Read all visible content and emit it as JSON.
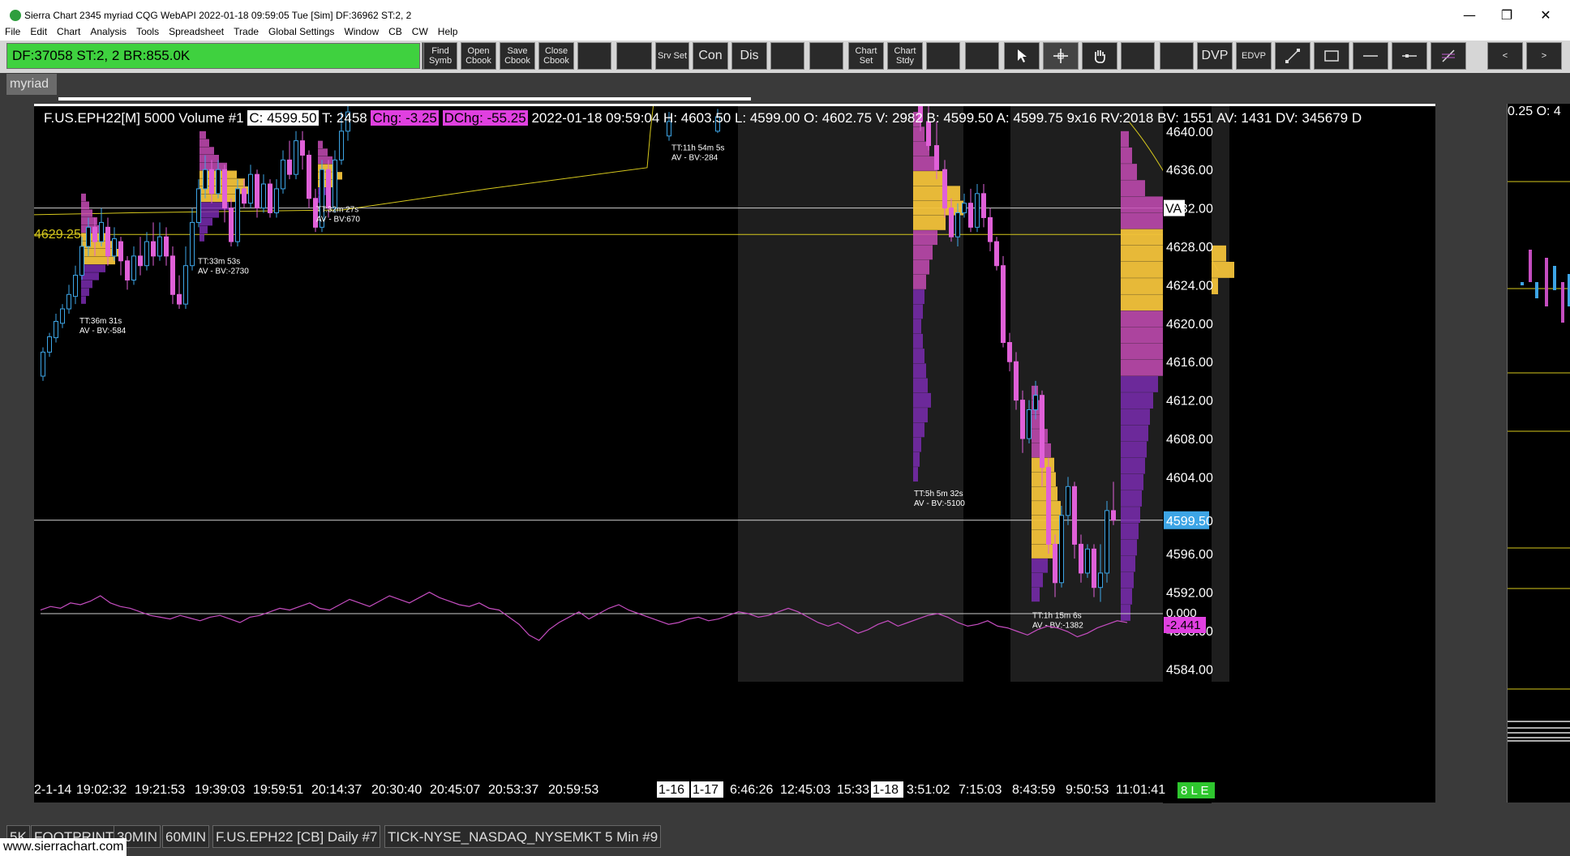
{
  "window": {
    "title": "Sierra Chart 2345 myriad  CQG WebAPI 2022-01-18  09:59:05 Tue [Sim]  DF:36962  ST:2, 2",
    "minimize": "—",
    "restore": "❐",
    "close": "✕"
  },
  "menu": [
    "File",
    "Edit",
    "Chart",
    "Analysis",
    "Tools",
    "Spreadsheet",
    "Trade",
    "Global Settings",
    "Window",
    "CB",
    "CW",
    "Help"
  ],
  "status": {
    "text": "DF:37058  ST:2, 2  BR:855.0K"
  },
  "toolbar": {
    "find_symb": "Find Symb",
    "open_cbook": "Open Cbook",
    "save_cbook": "Save Cbook",
    "close_cbook": "Close Cbook",
    "srv_set": "Srv Set",
    "con": "Con",
    "dis": "Dis",
    "chart_set": "Chart Set",
    "chart_stdy": "Chart Stdy",
    "dvp": "DVP",
    "edvp": "EDVP",
    "prev": "<",
    "next": ">"
  },
  "chartbook_tab": "myriad",
  "chart": {
    "symbol": "F.US.EPH22[M]  5000 Volume  #1",
    "close": "C: 4599.50",
    "trades": "T: 2458",
    "chg": "Chg: -3.25",
    "dchg": "DChg: -55.25",
    "details": "2022-01-18 09:59:04 H: 4603.50 L: 4599.00 O: 4602.75 V: 2982 B: 4599.50 A: 4599.75 9x16 RV:2018 BV: 1551 AV: 1431 DV: 345679 D",
    "left_level": "4629.25",
    "va_label": "VA",
    "price_box": "4599.50",
    "osc_zero": "0.000",
    "osc_value": "-2.441",
    "right_partial_header": "0.25 O: 4",
    "status_tag": "8 L E",
    "profile_notes": [
      {
        "tt": "TT:36m 31s",
        "av": "AV - BV:-584"
      },
      {
        "tt": "TT:33m 53s",
        "av": "AV - BV:-2730"
      },
      {
        "tt": "TT:32m 27s",
        "av": "AV - BV:670"
      },
      {
        "tt": "TT:11h 54m 5s",
        "av": "AV - BV:-284"
      },
      {
        "tt": "TT:5h 5m 32s",
        "av": "AV - BV:-5100"
      },
      {
        "tt": "TT:1h 15m 6s",
        "av": "AV - BV:-1382"
      }
    ],
    "time_labels": [
      "2-1-14",
      "19:02:32",
      "19:21:53",
      "19:39:03",
      "19:59:51",
      "20:14:37",
      "20:30:40",
      "20:45:07",
      "20:53:37",
      "20:59:53",
      "1-16",
      "1-17",
      "6:46:26",
      "12:45:03",
      "15:33",
      "1-18",
      "3:51:02",
      "7:15:03",
      "8:43:59",
      "9:50:53",
      "11:01:41"
    ]
  },
  "chart_data": {
    "type": "candlestick",
    "y_axis": {
      "ticks": [
        4640.0,
        4636.0,
        4632.0,
        4628.0,
        4624.0,
        4620.0,
        4616.0,
        4612.0,
        4608.0,
        4604.0,
        4596.0,
        4592.0,
        4588.0,
        4584.0
      ],
      "range": [
        4581.0,
        4642.6
      ]
    },
    "current_price": 4599.5,
    "value_area_line": 4632.0,
    "left_level": 4629.25,
    "oscillator": {
      "zero": 0.0,
      "last": -2.441
    }
  },
  "bottom_tabs": [
    "5K",
    "FOOTPRINT",
    "30MIN",
    "60MIN",
    "F.US.EPH22 [CB]  Daily  #7",
    "TICK-NYSE_NASDAQ_NYSEMKT  5 Min  #9"
  ],
  "footer": "www.sierrachart.com",
  "colors": {
    "up": "#3da5e6",
    "down": "#e060d8",
    "profile_hot": "#f2c23a",
    "profile_cool": "#6a1aa0",
    "status_green": "#3fd13f"
  }
}
